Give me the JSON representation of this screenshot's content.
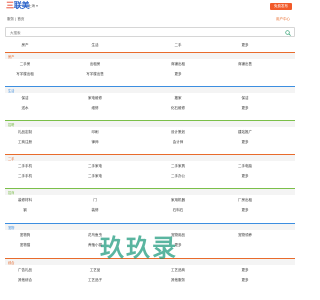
{
  "header": {
    "logo_mark": "三",
    "logo_text": "联美",
    "city_switch": "上海 ▾",
    "publish_label": "免费发布"
  },
  "subheader": {
    "left_text": "服务 | 首页",
    "right_text": "用户中心"
  },
  "search": {
    "placeholder": "大搜索",
    "icon": "search-icon"
  },
  "quick_links": [
    "房产",
    "生活",
    "二手",
    "更多"
  ],
  "sections": [
    {
      "title": "房产",
      "accent": "#e86b2c",
      "rows": [
        [
          "二手房",
          "出租房",
          "商铺出租",
          "商铺出售"
        ],
        [
          "写字楼出租",
          "写字楼出售",
          "更多"
        ]
      ]
    },
    {
      "title": "生活",
      "accent": "#3c8ee0",
      "rows": [
        [
          "保洁",
          "家电维修",
          "搬家",
          "保洁"
        ],
        [
          "送水",
          "维修",
          "化石维修",
          "更多"
        ]
      ]
    },
    {
      "title": "招聘",
      "accent": "#7bbf4a",
      "rows": [
        [
          "礼品定制",
          "印刷",
          "设计策划",
          "建站推广"
        ],
        [
          "工商注册",
          "律师",
          "会计师",
          "更多"
        ]
      ]
    },
    {
      "title": "二手",
      "accent": "#e86b2c",
      "rows": [
        [
          "二手手机",
          "二手家电",
          "二手家具",
          "二手电脑"
        ],
        [
          "二手手机",
          "二手家电",
          "二手办公",
          "更多"
        ]
      ]
    },
    {
      "title": "招商",
      "accent": "#7bbf4a",
      "rows": [
        [
          "装修材料",
          "门",
          "家用机器",
          "厂房出租"
        ],
        [
          "钢",
          "装修",
          "石料石",
          "更多"
        ]
      ]
    },
    {
      "title": "宠物",
      "accent": "#3c8ee0",
      "rows": [
        [
          "宠物狗",
          "花鸟鱼虫",
          "宠物用品",
          "宠物领养"
        ],
        [
          "宠物猫",
          "养殖小猫",
          "更多"
        ]
      ]
    },
    {
      "title": "综合",
      "accent": "#e86b2c",
      "rows": [
        [
          "广告礼品",
          "工艺品",
          "工艺品商",
          "更多"
        ],
        [
          "其他综合",
          "工艺品子",
          "其他服务",
          "更多"
        ]
      ]
    }
  ],
  "watermark": "玖玖录"
}
